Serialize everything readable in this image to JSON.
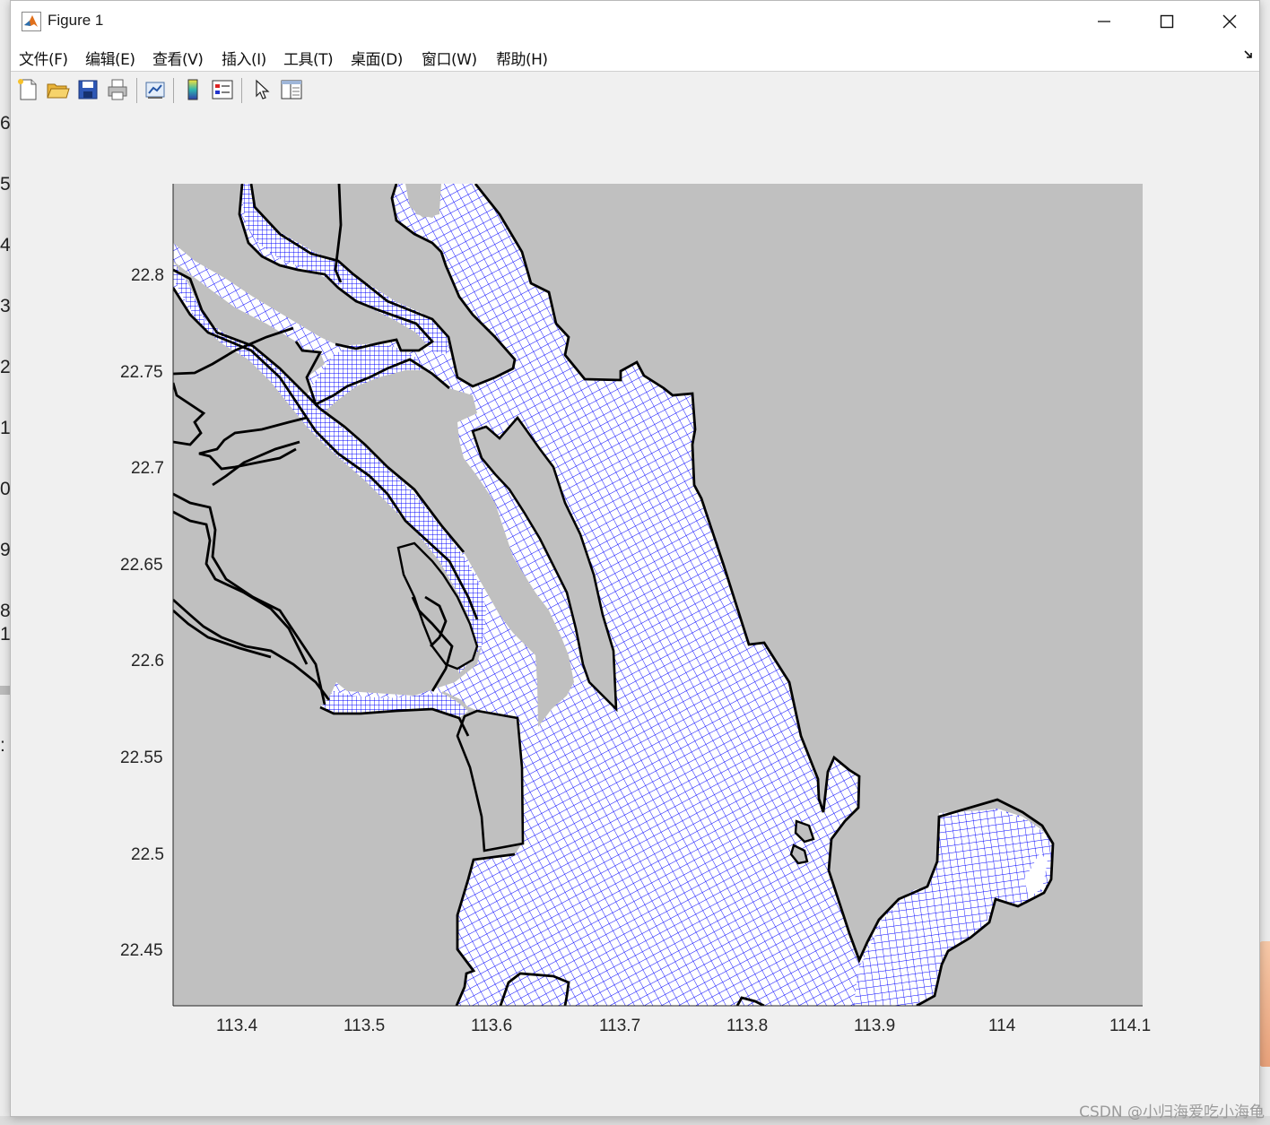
{
  "window": {
    "title": "Figure 1"
  },
  "menu": [
    "文件(F)",
    "编辑(E)",
    "查看(V)",
    "插入(I)",
    "工具(T)",
    "桌面(D)",
    "窗口(W)",
    "帮助(H)"
  ],
  "toolbar": [
    {
      "icon": "new-figure-icon"
    },
    {
      "icon": "open-folder-icon"
    },
    {
      "icon": "save-icon"
    },
    {
      "icon": "print-icon"
    },
    {
      "icon": "link-plot-icon"
    },
    {
      "icon": "colorbar-icon"
    },
    {
      "icon": "legend-icon"
    },
    {
      "icon": "edit-plot-arrow-icon"
    },
    {
      "icon": "property-editor-icon"
    }
  ],
  "background": {
    "left_digits": [
      "6",
      "5",
      "4",
      "3",
      "2",
      "1",
      "0",
      "9",
      "8",
      "1",
      ":"
    ]
  },
  "chart_data": {
    "type": "mesh-map",
    "xlim": [
      113.35,
      114.11
    ],
    "ylim": [
      22.423,
      22.848
    ],
    "xticks": [
      "113.4",
      "113.5",
      "113.6",
      "113.7",
      "113.8",
      "113.9",
      "114",
      "114.1"
    ],
    "yticks": [
      "22.8",
      "22.75",
      "22.7",
      "22.65",
      "22.6",
      "22.55",
      "22.5",
      "22.45"
    ],
    "land_color": "#c0c0c0",
    "mesh_color": "#0000ff",
    "coastline_color": "#000000",
    "grid": false
  },
  "watermark": "CSDN @小归海爱吃小海龟"
}
